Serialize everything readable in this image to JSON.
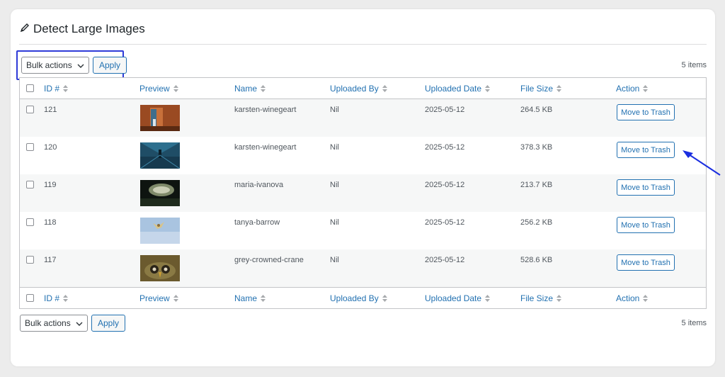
{
  "page": {
    "title": "Detect Large Images"
  },
  "bulk_top": {
    "select_value": "Bulk actions",
    "apply_label": "Apply"
  },
  "bulk_bottom": {
    "select_value": "Bulk actions",
    "apply_label": "Apply"
  },
  "items_count": "5 items",
  "columns": {
    "id": "ID #",
    "preview": "Preview",
    "name": "Name",
    "uploaded_by": "Uploaded By",
    "uploaded_date": "Uploaded Date",
    "file_size": "File Size",
    "action": "Action"
  },
  "rows": [
    {
      "id": "121",
      "name": "karsten-winegeart",
      "uploaded_by": "Nil",
      "date": "2025-05-12",
      "size": "264.5 KB",
      "action": "Move to Trash"
    },
    {
      "id": "120",
      "name": "karsten-winegeart",
      "uploaded_by": "Nil",
      "date": "2025-05-12",
      "size": "378.3 KB",
      "action": "Move to Trash"
    },
    {
      "id": "119",
      "name": "maria-ivanova",
      "uploaded_by": "Nil",
      "date": "2025-05-12",
      "size": "213.7 KB",
      "action": "Move to Trash"
    },
    {
      "id": "118",
      "name": "tanya-barrow",
      "uploaded_by": "Nil",
      "date": "2025-05-12",
      "size": "256.2 KB",
      "action": "Move to Trash"
    },
    {
      "id": "117",
      "name": "grey-crowned-crane",
      "uploaded_by": "Nil",
      "date": "2025-05-12",
      "size": "528.6 KB",
      "action": "Move to Trash"
    }
  ],
  "colors": {
    "accent": "#2271b1",
    "highlight_box": "#2f3bd8",
    "annotation_arrow": "#1a2ee0"
  },
  "icons": [
    "pencil-icon",
    "chevron-down-icon",
    "sort-icon",
    "annotation-arrow-icon"
  ]
}
